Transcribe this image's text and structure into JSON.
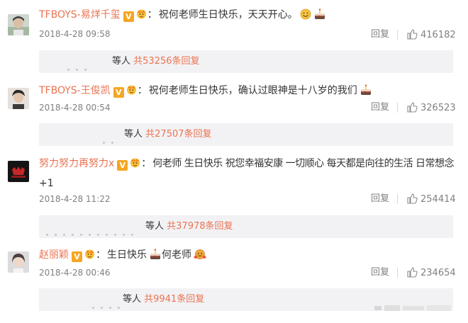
{
  "comments": [
    {
      "username": "TFBOYS-易烊千玺",
      "text": "祝何老师生日快乐，天天开心。",
      "emojis": [
        "smile-emoji",
        "cake-emoji"
      ],
      "time": "2018-4-28 09:58",
      "reply_label": "回复",
      "likes": "416182",
      "replies_prefix": "等人",
      "replies_count": "共53256条回复"
    },
    {
      "username": "TFBOYS-王俊凯",
      "text": "祝何老师生日快乐，确认过眼神是十八岁的我们",
      "emojis": [
        "cake-emoji"
      ],
      "time": "2018-4-28 00:54",
      "reply_label": "回复",
      "likes": "326523",
      "replies_prefix": "等人",
      "replies_count": "共27507条回复"
    },
    {
      "username": "努力努力再努力x",
      "text": "何老师 生日快乐 祝您幸福安康 一切顺心 每天都是向往的生活 日常想念",
      "text_cont": "+1",
      "emojis": [],
      "time": "2018-4-28 11:22",
      "reply_label": "回复",
      "likes": "254414",
      "replies_prefix": "等人",
      "replies_count": "共37978条回复"
    },
    {
      "username": "赵丽颖",
      "text": "生日快乐",
      "text_after": "何老师",
      "emojis": [
        "cake-emoji",
        "hug-emoji"
      ],
      "time": "2018-4-28 00:46",
      "reply_label": "回复",
      "likes": "234654",
      "replies_prefix": "等人",
      "replies_count": "共9941条回复"
    }
  ],
  "badge_label": "V",
  "colors": {
    "username": "#eb7350",
    "reply_count": "#eb7350",
    "badge": "#f5a623",
    "meta": "#808080",
    "reply_box": "#f2f2f5"
  }
}
